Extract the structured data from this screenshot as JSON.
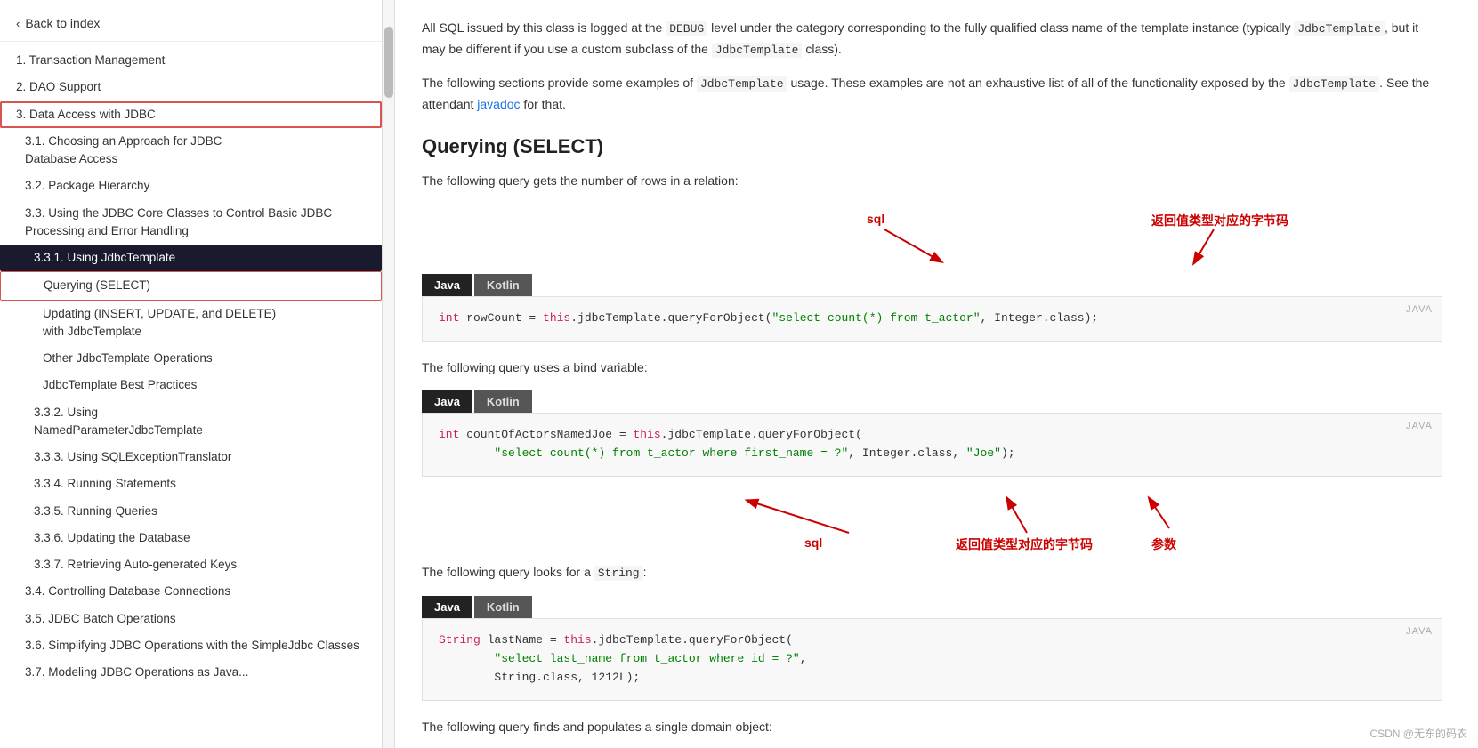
{
  "sidebar": {
    "back_label": "Back to index",
    "items": [
      {
        "id": "item-1",
        "label": "1. Transaction Management",
        "level": 1,
        "active": false
      },
      {
        "id": "item-2",
        "label": "2. DAO Support",
        "level": 1,
        "active": false
      },
      {
        "id": "item-3",
        "label": "3. Data Access with JDBC",
        "level": 1,
        "active": false,
        "highlighted": true
      },
      {
        "id": "item-3-1",
        "label": "3.1. Choosing an Approach for JDBC Database Access",
        "level": 2,
        "active": false
      },
      {
        "id": "item-3-2",
        "label": "3.2. Package Hierarchy",
        "level": 2,
        "active": false
      },
      {
        "id": "item-3-3",
        "label": "3.3. Using the JDBC Core Classes to Control Basic JDBC Processing and Error Handling",
        "level": 2,
        "active": false
      },
      {
        "id": "item-3-3-1",
        "label": "3.3.1. Using JdbcTemplate",
        "level": 3,
        "active": true
      },
      {
        "id": "item-q-select",
        "label": "Querying (SELECT)",
        "level": 4,
        "active": false,
        "sub_highlighted": true
      },
      {
        "id": "item-update",
        "label": "Updating (INSERT, UPDATE, and DELETE) with JdbcTemplate",
        "level": 4,
        "active": false
      },
      {
        "id": "item-other",
        "label": "Other JdbcTemplate Operations",
        "level": 4,
        "active": false
      },
      {
        "id": "item-best",
        "label": "JdbcTemplate Best Practices",
        "level": 4,
        "active": false
      },
      {
        "id": "item-3-3-2",
        "label": "3.3.2. Using NamedParameterJdbcTemplate",
        "level": 3,
        "active": false
      },
      {
        "id": "item-3-3-3",
        "label": "3.3.3. Using SQLExceptionTranslator",
        "level": 3,
        "active": false
      },
      {
        "id": "item-3-3-4",
        "label": "3.3.4. Running Statements",
        "level": 3,
        "active": false
      },
      {
        "id": "item-3-3-5",
        "label": "3.3.5. Running Queries",
        "level": 3,
        "active": false
      },
      {
        "id": "item-3-3-6",
        "label": "3.3.6. Updating the Database",
        "level": 3,
        "active": false
      },
      {
        "id": "item-3-3-7",
        "label": "3.3.7. Retrieving Auto-generated Keys",
        "level": 3,
        "active": false
      },
      {
        "id": "item-3-4",
        "label": "3.4. Controlling Database Connections",
        "level": 2,
        "active": false
      },
      {
        "id": "item-3-5",
        "label": "3.5. JDBC Batch Operations",
        "level": 2,
        "active": false
      },
      {
        "id": "item-3-6",
        "label": "3.6. Simplifying JDBC Operations with the SimpleJdbc Classes",
        "level": 2,
        "active": false
      },
      {
        "id": "item-3-7",
        "label": "3.7. Modeling JDBC Operations as Java...",
        "level": 2,
        "active": false
      }
    ]
  },
  "content": {
    "intro_para1_before": "All SQL issued by this class is logged at the",
    "intro_debug": "DEBUG",
    "intro_para1_after": "level under the category corresponding to the fully qualified class name of the template instance (typically",
    "intro_jdbctemplate1": "JdbcTemplate",
    "intro_para1_cont": ", but it may be different if you use a custom subclass of the",
    "intro_jdbctemplate2": "JdbcTemplate",
    "intro_para1_end": "class).",
    "intro_para2_before": "The following sections provide some examples of",
    "intro_jdbctemplate3": "JdbcTemplate",
    "intro_para2_after": "usage. These examples are not an exhaustive list of all of the functionality exposed by the",
    "intro_jdbctemplate4": "JdbcTemplate",
    "intro_para2_cont": ". See the attendant",
    "intro_javadoc": "javadoc",
    "intro_para2_end": "for that.",
    "section_heading": "Querying (SELECT)",
    "query1_label": "The following query gets the number of rows in a relation:",
    "anno1_sql": "sql",
    "anno1_return": "返回值类型对应的字节码",
    "tab1_java": "Java",
    "tab1_kotlin": "Kotlin",
    "code1_java_label": "JAVA",
    "code1_line": "int rowCount = this.jdbcTemplate.queryForObject(\"select count(*) from t_actor\", Integer.class);",
    "query2_label": "The following query uses a bind variable:",
    "tab2_java": "Java",
    "tab2_kotlin": "Kotlin",
    "code2_java_label": "JAVA",
    "code2_line1": "int countOfActorsNamedJoe = this.jdbcTemplate.queryForObject(",
    "code2_line2": "        \"select count(*) from t_actor where first_name = ?\", Integer.class, \"Joe\");",
    "anno2_sql": "sql",
    "anno2_return": "返回值类型对应的字节码",
    "anno2_param": "参数",
    "query3_label_before": "The following query looks for a",
    "query3_string": "String",
    "query3_label_after": ":",
    "tab3_java": "Java",
    "tab3_kotlin": "Kotlin",
    "code3_java_label": "JAVA",
    "code3_line1": "String lastName = this.jdbcTemplate.queryForObject(",
    "code3_line2": "        \"select last_name from t_actor where id = ?\",",
    "code3_line3": "        String.class, 1212L);",
    "query4_label": "The following query finds and populates a single domain object:",
    "watermark": "CSDN @无东的码农"
  }
}
